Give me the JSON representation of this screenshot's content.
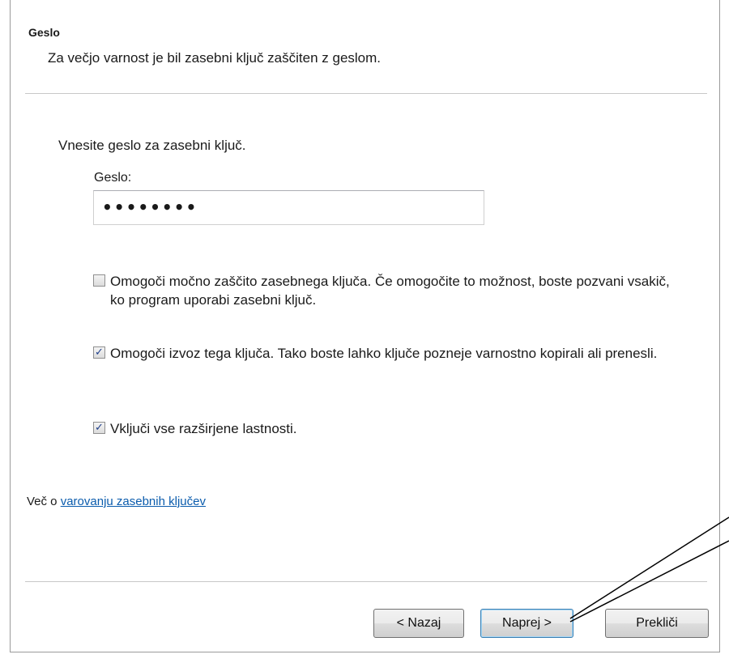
{
  "header": {
    "title": "Geslo",
    "description": "Za večjo varnost je bil zasebni ključ zaščiten z geslom."
  },
  "form": {
    "prompt": "Vnesite geslo za zasebni ključ.",
    "password_label": "Geslo:",
    "password_value": "••••••••"
  },
  "options": [
    {
      "label": "Omogoči močno zaščito zasebnega ključa. Če omogočite to možnost, boste pozvani vsakič, ko program uporabi zasebni ključ.",
      "checked": false,
      "mark": ""
    },
    {
      "label": "Omogoči izvoz tega ključa. Tako boste lahko ključe pozneje varnostno kopirali ali prenesli.",
      "checked": true,
      "mark": "✓"
    },
    {
      "label": "Vključi vse razširjene lastnosti.",
      "checked": true,
      "mark": "✓"
    }
  ],
  "more_info": {
    "prefix": "Več o",
    "link_text": "varovanju zasebnih ključev"
  },
  "buttons": {
    "back": "< Nazaj",
    "next": "Naprej >",
    "cancel": "Prekliči"
  }
}
